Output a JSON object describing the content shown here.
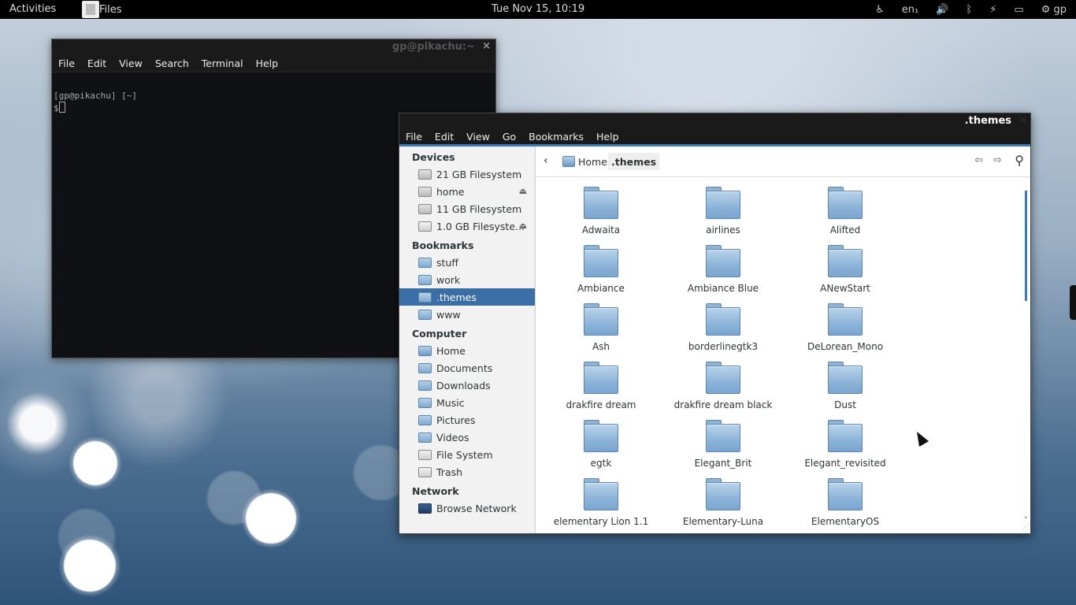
{
  "topbar": {
    "activities": "Activities",
    "app_name": "Files",
    "clock": "Tue Nov 15, 10:19",
    "keyboard_layout": "en₁",
    "user": "gp",
    "icons": [
      "accessibility-icon",
      "volume-icon",
      "bluetooth-icon",
      "network-icon",
      "battery-icon",
      "user-icon"
    ]
  },
  "terminal": {
    "title": "gp@pikachu:~",
    "menu": [
      "File",
      "Edit",
      "View",
      "Search",
      "Terminal",
      "Help"
    ],
    "line1": "[gp@pikachu] [~]",
    "prompt": "$"
  },
  "files": {
    "title": ".themes",
    "menu": [
      "File",
      "Edit",
      "View",
      "Go",
      "Bookmarks",
      "Help"
    ],
    "path": {
      "home": "Home",
      "current": ".themes"
    },
    "sidebar": {
      "devices_header": "Devices",
      "devices": [
        "21 GB Filesystem",
        "home",
        "11 GB Filesystem",
        "1.0 GB Filesyste..."
      ],
      "bookmarks_header": "Bookmarks",
      "bookmarks": [
        "stuff",
        "work",
        ".themes",
        "www"
      ],
      "computer_header": "Computer",
      "computer": [
        "Home",
        "Documents",
        "Downloads",
        "Music",
        "Pictures",
        "Videos",
        "File System",
        "Trash"
      ],
      "network_header": "Network",
      "network": [
        "Browse Network"
      ]
    },
    "folders": [
      "Adwaita",
      "airlines",
      "Alifted",
      "Ambiance",
      "Ambiance Blue",
      "ANewStart",
      "Ash",
      "borderlinegtk3",
      "DeLorean_Mono",
      "drakfire dream",
      "drakfire dream black",
      "Dust",
      "egtk",
      "Elegant_Brit",
      "Elegant_revisited",
      "elementary Lion 1.1",
      "Elementary-Luna",
      "ElementaryOS"
    ],
    "accent_color": "#3b6ea5"
  }
}
